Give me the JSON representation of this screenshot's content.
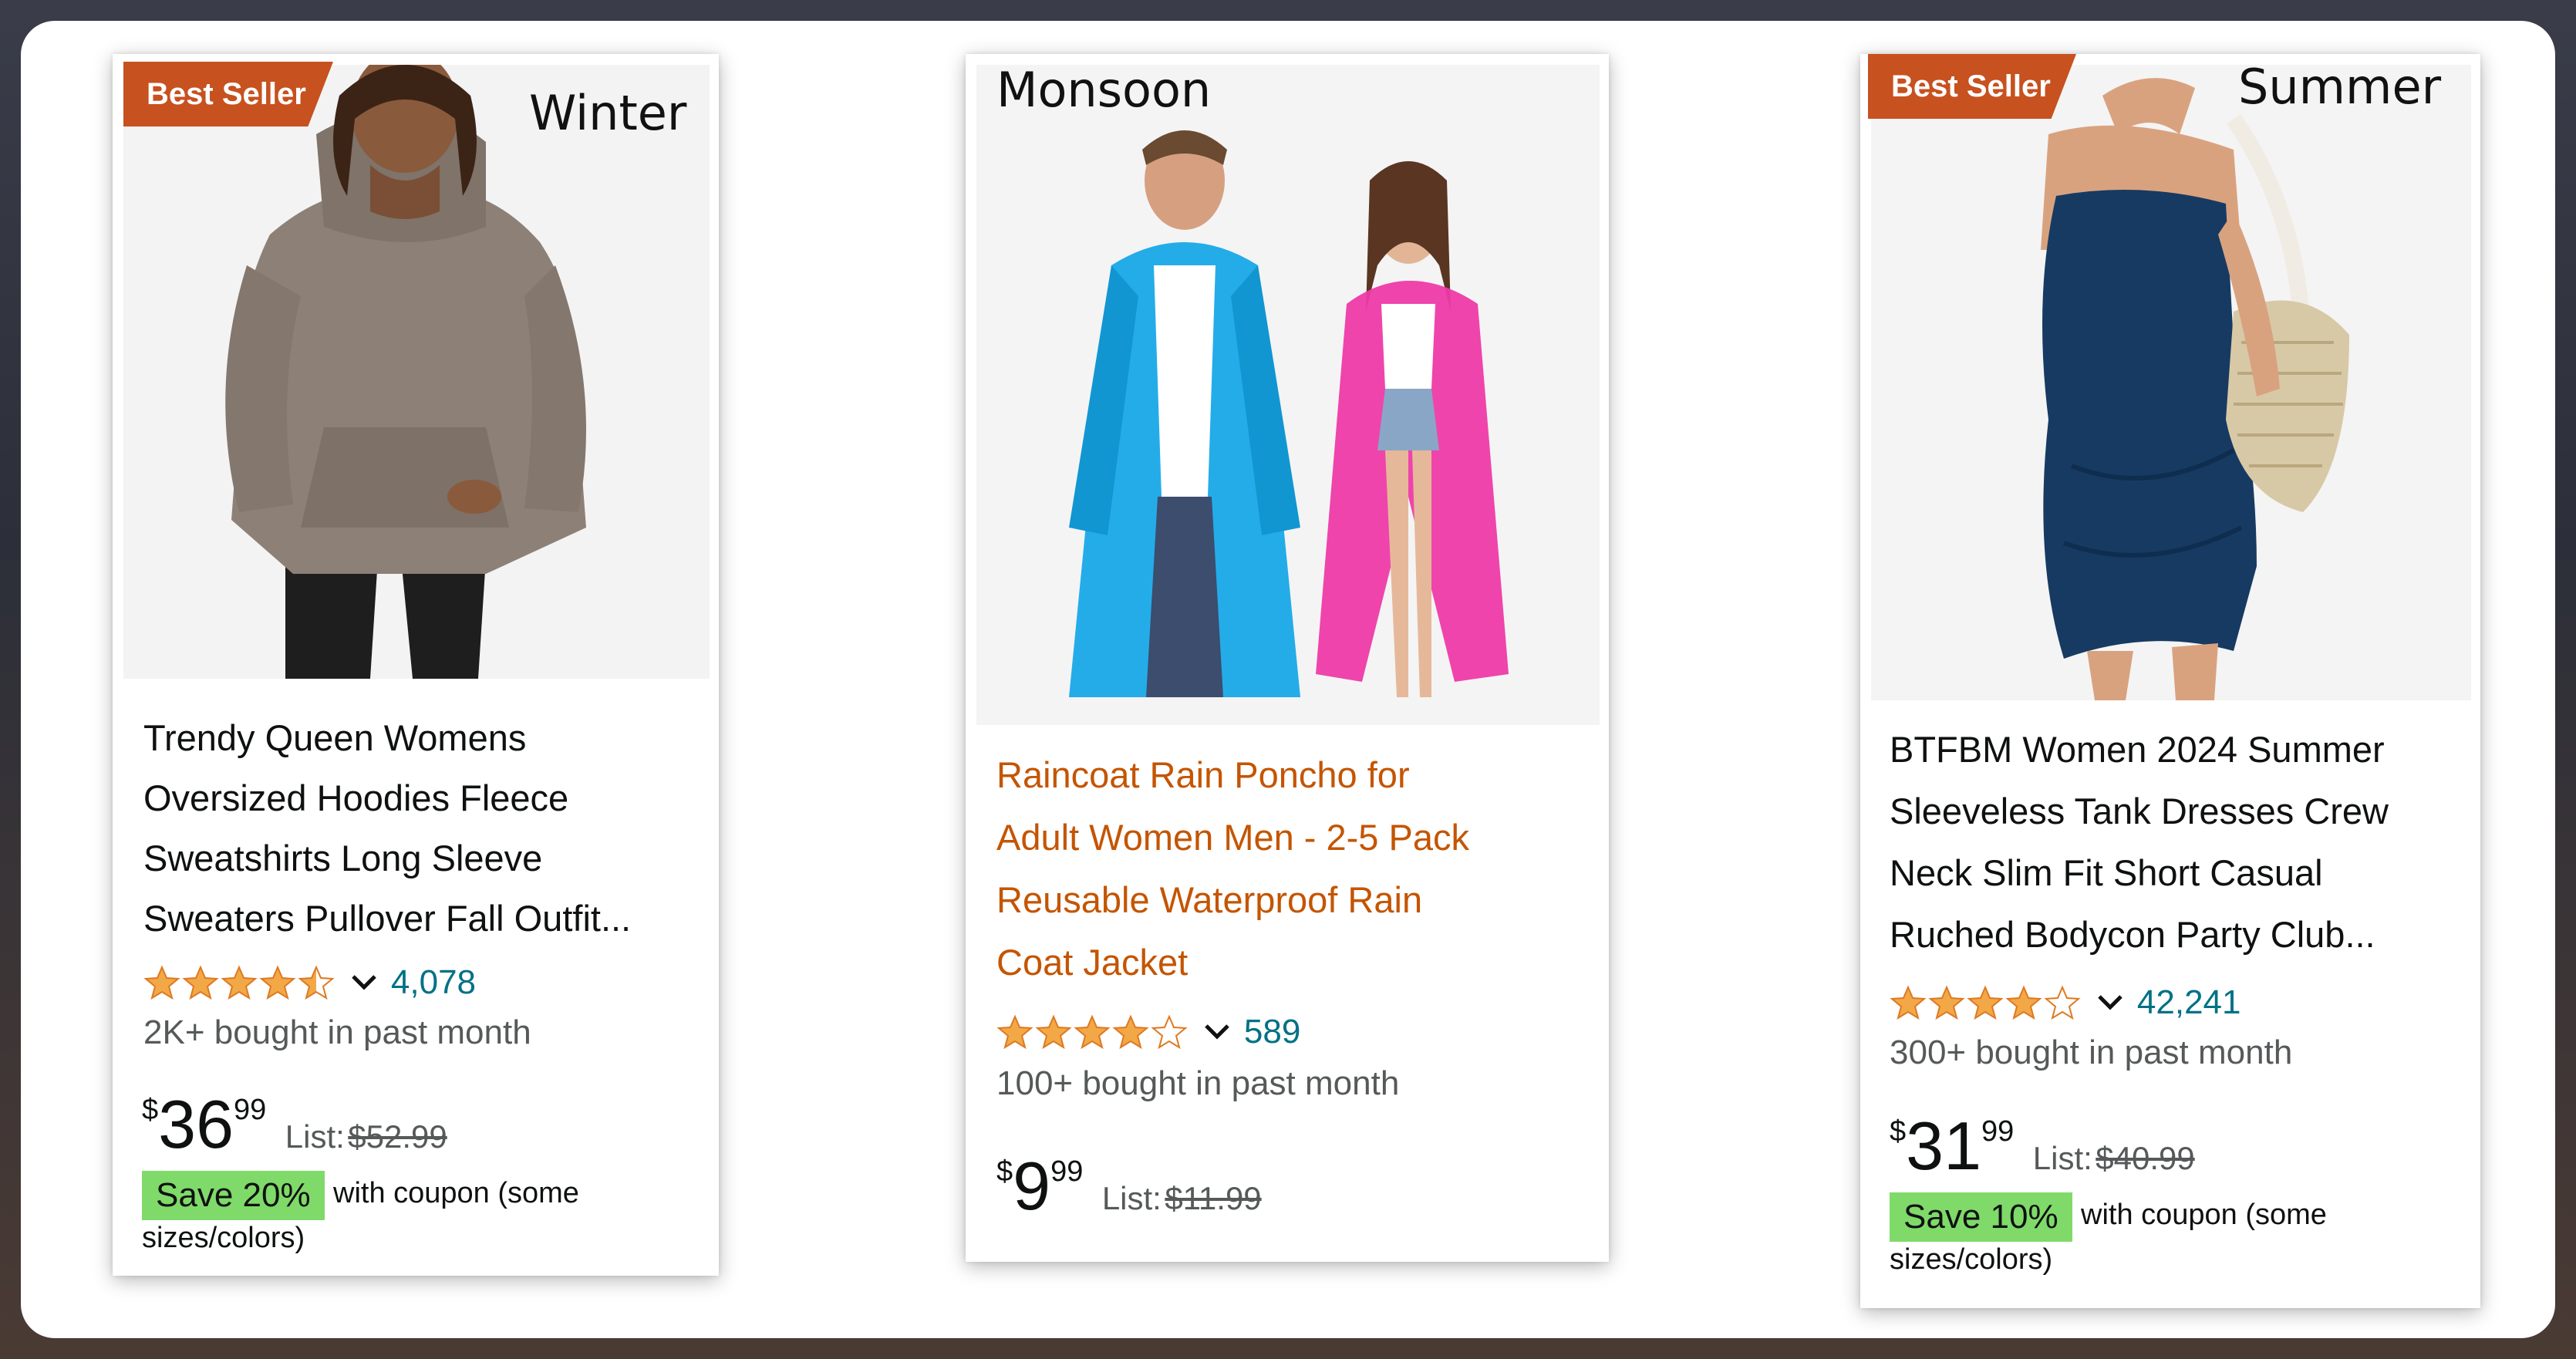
{
  "colors": {
    "badge": "#c7511f",
    "rating_count": "#007185",
    "star": "#f3a847",
    "save_badge": "#7fda69",
    "sponsored_title": "#c45500"
  },
  "products": [
    {
      "season": "Winter",
      "badge": "Best Seller",
      "image": "hoodie-product-image",
      "title_lines": [
        "Trendy Queen Womens",
        "Oversized Hoodies Fleece",
        "Sweatshirts Long Sleeve",
        "Sweaters Pullover Fall Outfit..."
      ],
      "rating": 4.5,
      "rating_count": "4,078",
      "bought": "2K+ bought in past month",
      "price": {
        "currency": "$",
        "whole": "36",
        "fraction": "99"
      },
      "list_label": "List:",
      "list_price": "$52.99",
      "save_label": "Save 20%",
      "coupon_lines": [
        "with coupon (some",
        "sizes/colors)"
      ]
    },
    {
      "season": "Monsoon",
      "badge": "",
      "image": "raincoat-product-image",
      "title_lines": [
        "Raincoat Rain Poncho for",
        "Adult Women Men - 2-5 Pack",
        "Reusable Waterproof Rain",
        "Coat Jacket"
      ],
      "rating": 4.0,
      "rating_count": "589",
      "bought": "100+ bought in past month",
      "price": {
        "currency": "$",
        "whole": "9",
        "fraction": "99"
      },
      "list_label": "List:",
      "list_price": "$11.99"
    },
    {
      "season": "Summer",
      "badge": "Best Seller",
      "image": "dress-product-image",
      "title_lines": [
        "BTFBM Women 2024 Summer",
        "Sleeveless Tank Dresses Crew",
        "Neck Slim Fit Short Casual",
        "Ruched Bodycon Party Club..."
      ],
      "rating": 4.0,
      "rating_count": "42,241",
      "bought": "300+ bought in past month",
      "price": {
        "currency": "$",
        "whole": "31",
        "fraction": "99"
      },
      "list_label": "List:",
      "list_price": "$40.99",
      "save_label": "Save 10%",
      "coupon_lines": [
        "with coupon (some",
        "sizes/colors)"
      ]
    }
  ]
}
